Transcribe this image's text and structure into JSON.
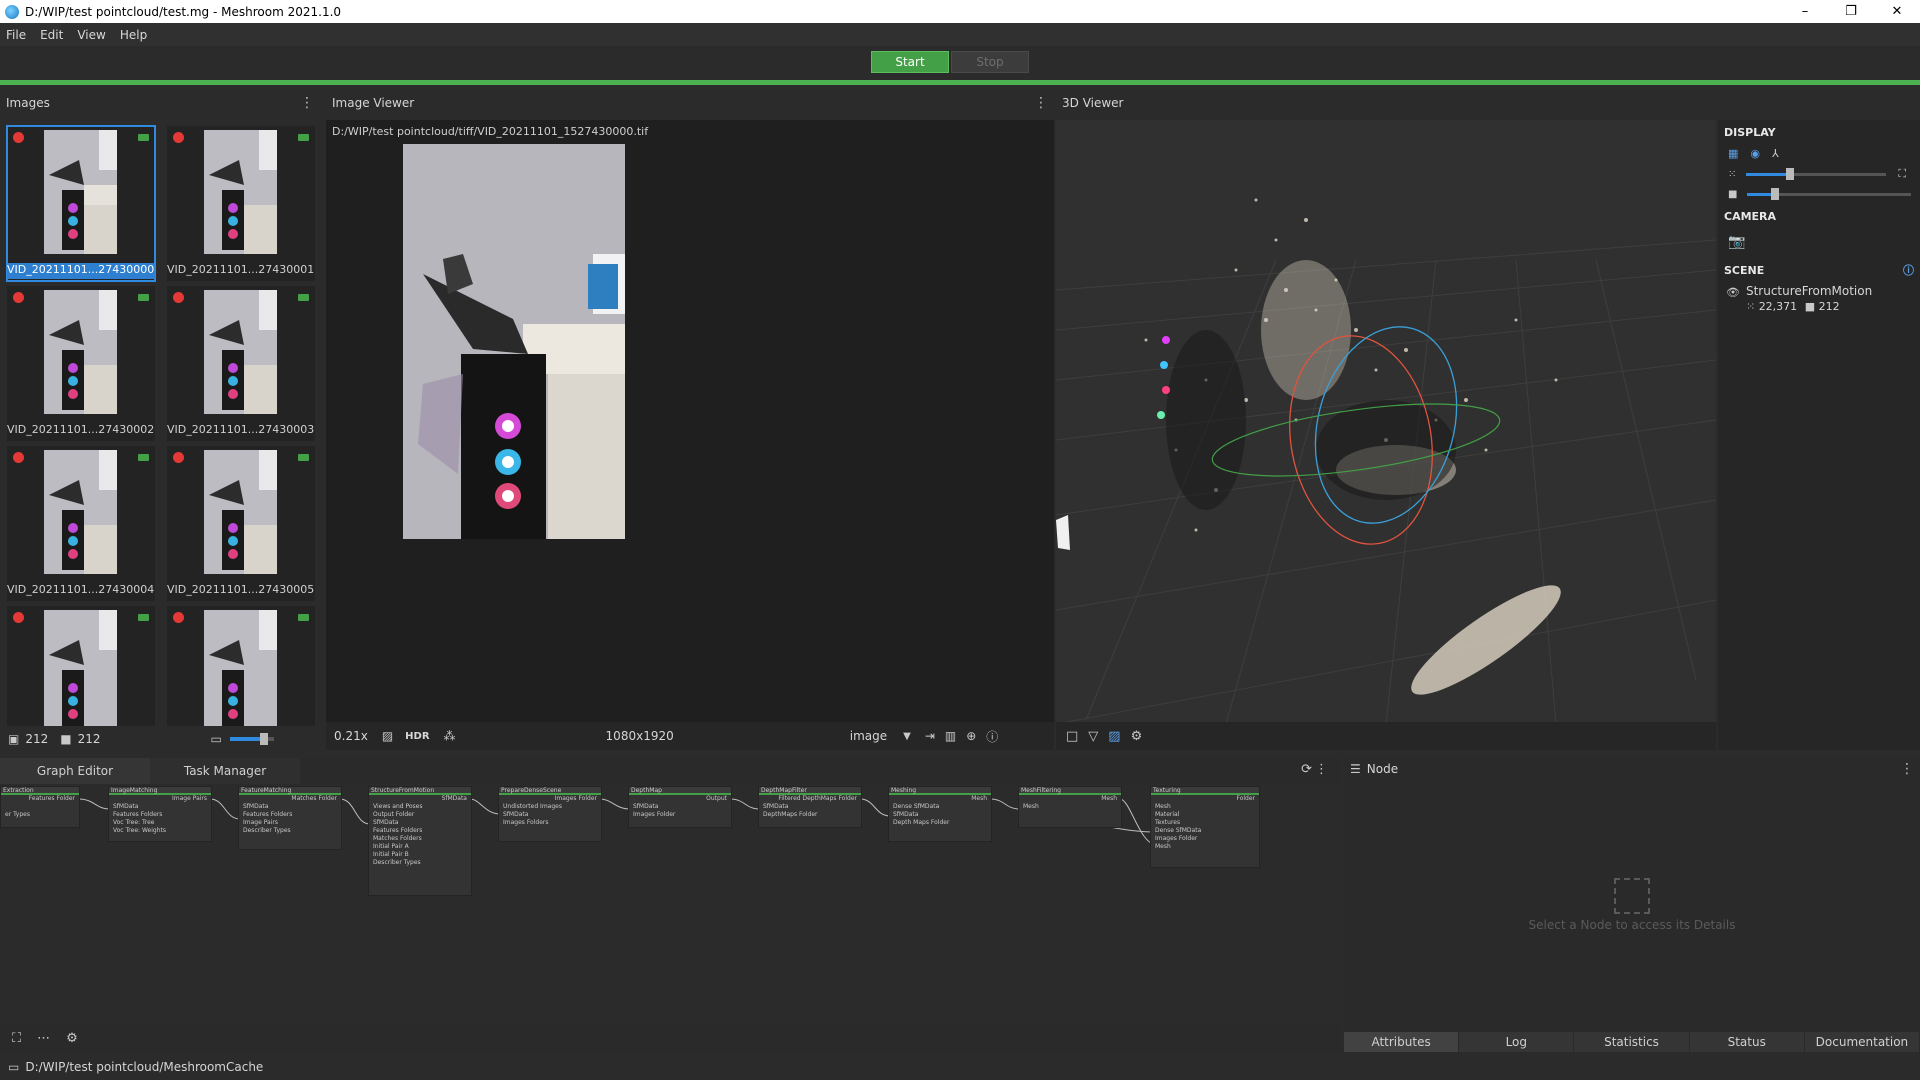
{
  "window": {
    "title": "D:/WIP/test pointcloud/test.mg - Meshroom 2021.1.0",
    "controls": {
      "minimize": "–",
      "restore": "❐",
      "close": "✕"
    }
  },
  "menu": [
    "File",
    "Edit",
    "View",
    "Help"
  ],
  "run": {
    "start_label": "Start",
    "stop_label": "Stop",
    "accent": "#43a047"
  },
  "images_panel": {
    "title": "Images",
    "thumbnails": [
      {
        "label": "VID_20211101...27430000.tif",
        "selected": true
      },
      {
        "label": "VID_20211101...27430001.tif"
      },
      {
        "label": "VID_20211101...27430002.tif"
      },
      {
        "label": "VID_20211101...27430003.tif"
      },
      {
        "label": "VID_20211101...27430004.tif"
      },
      {
        "label": "VID_20211101...27430005.tif"
      },
      {
        "label": ""
      },
      {
        "label": ""
      }
    ],
    "footer": {
      "image_count": "212",
      "camera_count": "212"
    }
  },
  "image_viewer": {
    "title": "Image Viewer",
    "path": "D:/WIP/test pointcloud/tiff/VID_20211101_1527430000.tif",
    "zoom": "0.21x",
    "hdr_label": "HDR",
    "resolution": "1080x1920",
    "mode_select": "image"
  },
  "viewer3d": {
    "title": "3D Viewer",
    "display_title": "DISPLAY",
    "camera_title": "CAMERA",
    "scene_title": "SCENE",
    "scene_item": {
      "name": "StructureFromMotion",
      "points": "22,371",
      "cameras": "212"
    }
  },
  "graph_editor": {
    "tabs": [
      "Graph Editor",
      "Task Manager"
    ],
    "nodes": [
      {
        "title": "Extraction",
        "ports": [
          "Features Folder",
          "",
          "er Types"
        ]
      },
      {
        "title": "ImageMatching",
        "ports": [
          "Image Pairs",
          "SfMData",
          "Features Folders",
          "Voc Tree: Tree",
          "Voc Tree: Weights"
        ]
      },
      {
        "title": "FeatureMatching",
        "ports": [
          "Matches Folder",
          "SfMData",
          "Features Folders",
          "Image Pairs",
          "Describer Types"
        ]
      },
      {
        "title": "StructureFromMotion",
        "ports": [
          "SfMData",
          "Views and Poses",
          "Output Folder",
          "SfMData",
          "Features Folders",
          "Matches Folders",
          "Initial Pair A",
          "Initial Pair B",
          "Describer Types"
        ]
      },
      {
        "title": "PrepareDenseScene",
        "ports": [
          "Images Folder",
          "Undistorted Images",
          "SfMData",
          "Images Folders"
        ]
      },
      {
        "title": "DepthMap",
        "ports": [
          "Output",
          "SfMData",
          "Images Folder"
        ]
      },
      {
        "title": "DepthMapFilter",
        "ports": [
          "Filtered DepthMaps Folder",
          "SfMData",
          "DepthMaps Folder"
        ]
      },
      {
        "title": "Meshing",
        "ports": [
          "Mesh",
          "Dense SfMData",
          "SfMData",
          "Depth Maps Folder"
        ]
      },
      {
        "title": "MeshFiltering",
        "ports": [
          "Mesh",
          "Mesh"
        ]
      },
      {
        "title": "Texturing",
        "ports": [
          "Folder",
          "Mesh",
          "Material",
          "Textures",
          "Dense SfMData",
          "Images Folder",
          "Mesh"
        ]
      }
    ]
  },
  "node_panel": {
    "title": "Node",
    "placeholder": "Select a Node to access its Details",
    "tabs": [
      "Attributes",
      "Log",
      "Statistics",
      "Status",
      "Documentation"
    ]
  },
  "status_bar": {
    "cache_path": "D:/WIP/test pointcloud/MeshroomCache"
  }
}
